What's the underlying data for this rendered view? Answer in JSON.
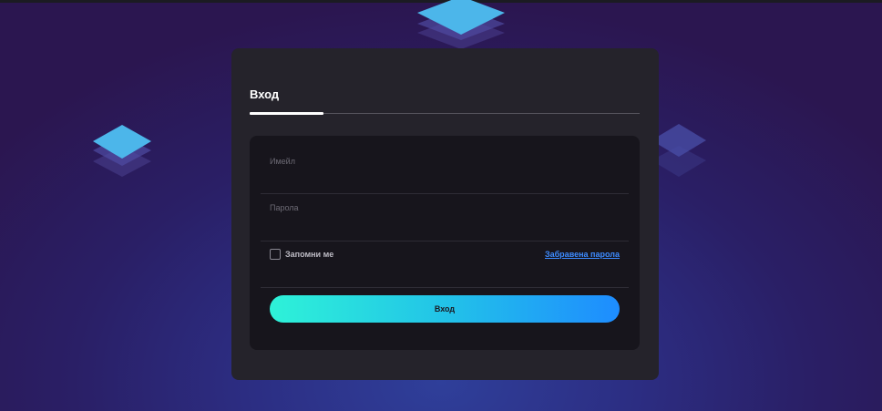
{
  "tabs": {
    "active_label": "Вход"
  },
  "form": {
    "email_label": "Имейл",
    "email_value": "",
    "password_label": "Парола",
    "password_value": "",
    "remember_label": "Запомни ме",
    "remember_checked": false,
    "forgot_link": "Забравена парола",
    "submit_label": "Вход"
  },
  "colors": {
    "accent_start": "#2ef2d8",
    "accent_end": "#1e8cff",
    "link": "#3d8bff",
    "card_bg": "#25232b",
    "form_bg": "#17151c"
  }
}
